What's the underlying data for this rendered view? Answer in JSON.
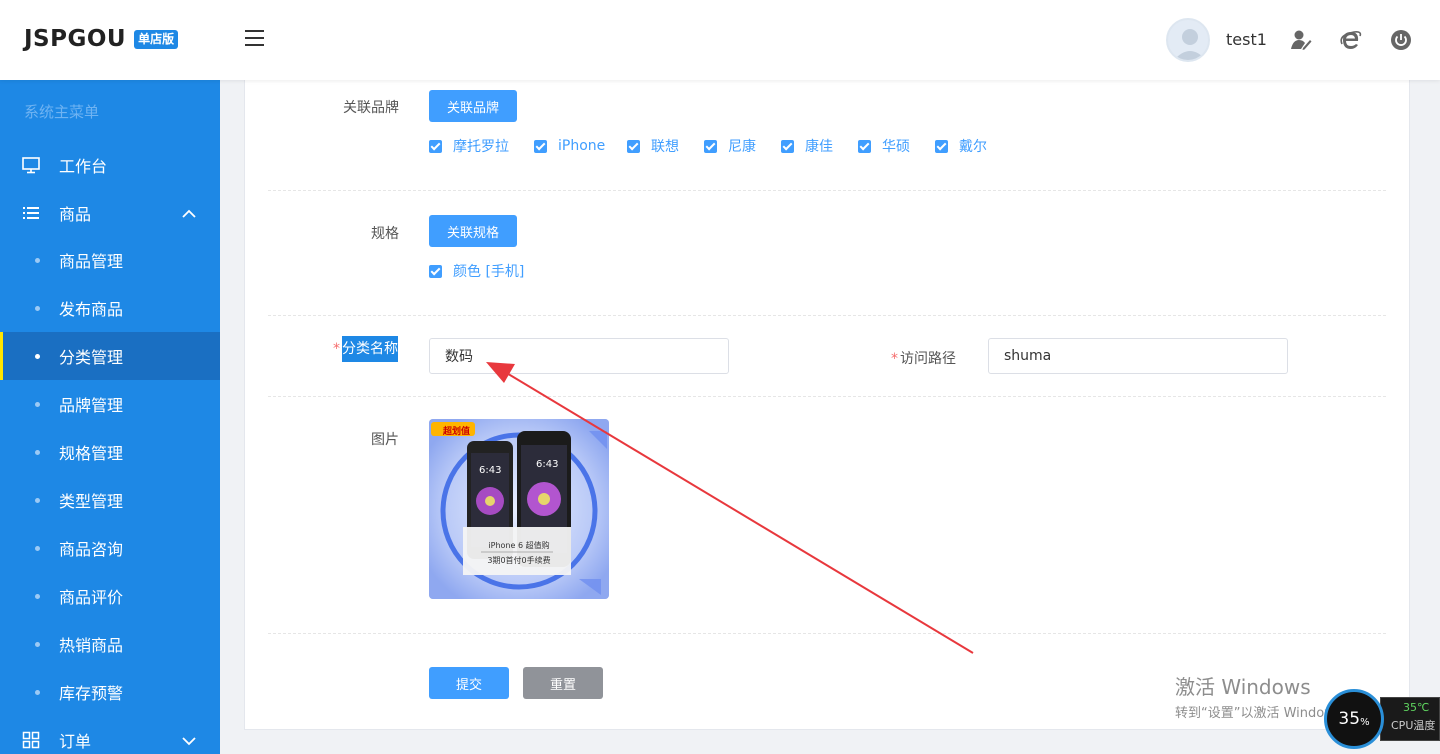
{
  "header": {
    "logo": "JSPGOU",
    "badge": "单店版",
    "username": "test1"
  },
  "sidebar": {
    "title": "系统主菜单",
    "items": [
      {
        "label": "工作台"
      },
      {
        "label": "商品"
      },
      {
        "label": "商品管理"
      },
      {
        "label": "发布商品"
      },
      {
        "label": "分类管理"
      },
      {
        "label": "品牌管理"
      },
      {
        "label": "规格管理"
      },
      {
        "label": "类型管理"
      },
      {
        "label": "商品咨询"
      },
      {
        "label": "商品评价"
      },
      {
        "label": "热销商品"
      },
      {
        "label": "库存预警"
      },
      {
        "label": "订单"
      }
    ]
  },
  "form": {
    "brand": {
      "label": "关联品牌",
      "button": "关联品牌",
      "options": [
        "摩托罗拉",
        "iPhone",
        "联想",
        "尼康",
        "康佳",
        "华硕",
        "戴尔"
      ]
    },
    "spec": {
      "label": "规格",
      "button": "关联规格",
      "options": [
        "颜色 [手机]"
      ]
    },
    "category_name": {
      "required": "*",
      "label": "分类名称",
      "value": "数码"
    },
    "access_path": {
      "required": "*",
      "label": "访问路径",
      "value": "shuma"
    },
    "image": {
      "label": "图片",
      "badge": "超划值",
      "caption1": "iPhone 6 超值购",
      "caption2": "3期0首付0手续费",
      "time1": "6:43",
      "time2": "6:43"
    },
    "submit": "提交",
    "reset": "重置"
  },
  "overlay": {
    "watermark_title": "激活 Windows",
    "watermark_sub": "转到“设置”以激活 Windows。",
    "cpu_percent": "35",
    "cpu_unit": "%",
    "cpu_temp": "35℃",
    "cpu_label": "CPU温度"
  },
  "colors": {
    "sidebar": "#1e88e5",
    "primary": "#409eff",
    "arrow": "#e8383d"
  }
}
